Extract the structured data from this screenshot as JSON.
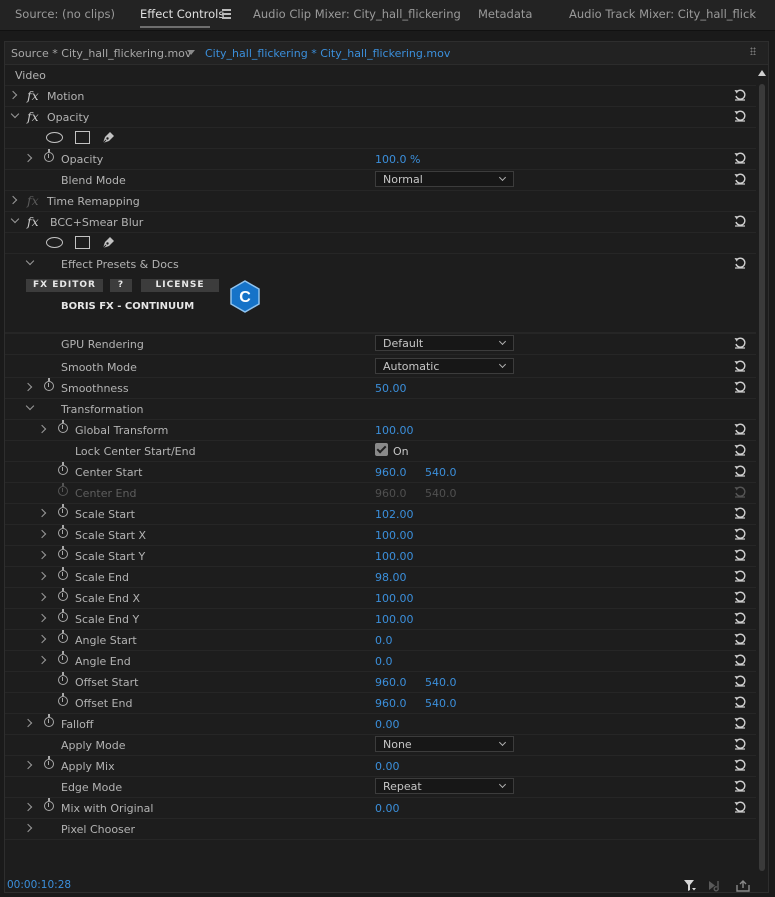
{
  "tabs": [
    {
      "label": "Source: (no clips)"
    },
    {
      "label": "Effect Controls"
    },
    {
      "label": "Audio Clip Mixer: City_hall_flickering"
    },
    {
      "label": "Metadata"
    },
    {
      "label": "Audio Track Mixer: City_hall_flick"
    }
  ],
  "subheader": {
    "source_clip": "Source * City_hall_flickering.mov",
    "sequence_clip": "City_hall_flickering * City_hall_flickering.mov"
  },
  "section": {
    "label": "Video"
  },
  "effects": {
    "motion": "Motion",
    "opacity": "Opacity",
    "opacity_param": {
      "label": "Opacity",
      "value": "100.0 %"
    },
    "blend_mode": {
      "label": "Blend Mode",
      "value": "Normal"
    },
    "time_remapping": "Time Remapping",
    "bcc": "BCC+Smear Blur",
    "presets": "Effect Presets & Docs",
    "buttons": {
      "fx_editor": "FX EDITOR",
      "help": "?",
      "license": "LICENSE"
    },
    "brand": "BORIS FX - CONTINUUM",
    "logo_letter": "C"
  },
  "params": {
    "gpu": {
      "label": "GPU Rendering",
      "value": "Default"
    },
    "smooth_mode": {
      "label": "Smooth Mode",
      "value": "Automatic"
    },
    "smoothness": {
      "label": "Smoothness",
      "value": "50.00"
    },
    "transformation": {
      "label": "Transformation"
    },
    "global_transform": {
      "label": "Global Transform",
      "value": "100.00"
    },
    "lock_center": {
      "label": "Lock Center Start/End",
      "value": "On"
    },
    "center_start": {
      "label": "Center Start",
      "x": "960.0",
      "y": "540.0"
    },
    "center_end": {
      "label": "Center End",
      "x": "960.0",
      "y": "540.0"
    },
    "scale_start": {
      "label": "Scale Start",
      "value": "102.00"
    },
    "scale_start_x": {
      "label": "Scale Start X",
      "value": "100.00"
    },
    "scale_start_y": {
      "label": "Scale Start Y",
      "value": "100.00"
    },
    "scale_end": {
      "label": "Scale End",
      "value": "98.00"
    },
    "scale_end_x": {
      "label": "Scale End X",
      "value": "100.00"
    },
    "scale_end_y": {
      "label": "Scale End Y",
      "value": "100.00"
    },
    "angle_start": {
      "label": "Angle Start",
      "value": "0.0"
    },
    "angle_end": {
      "label": "Angle End",
      "value": "0.0"
    },
    "offset_start": {
      "label": "Offset Start",
      "x": "960.0",
      "y": "540.0"
    },
    "offset_end": {
      "label": "Offset End",
      "x": "960.0",
      "y": "540.0"
    },
    "falloff": {
      "label": "Falloff",
      "value": "0.00"
    },
    "apply_mode": {
      "label": "Apply Mode",
      "value": "None"
    },
    "apply_mix": {
      "label": "Apply Mix",
      "value": "0.00"
    },
    "edge_mode": {
      "label": "Edge Mode",
      "value": "Repeat"
    },
    "mix_original": {
      "label": "Mix with Original",
      "value": "0.00"
    },
    "pixel_chooser": {
      "label": "Pixel Chooser"
    }
  },
  "footer": {
    "timecode": "00:00:10:28"
  },
  "colors": {
    "accent_blue": "#3b8fdb",
    "background": "#1d1d1d",
    "text": "#b3b3b3"
  }
}
